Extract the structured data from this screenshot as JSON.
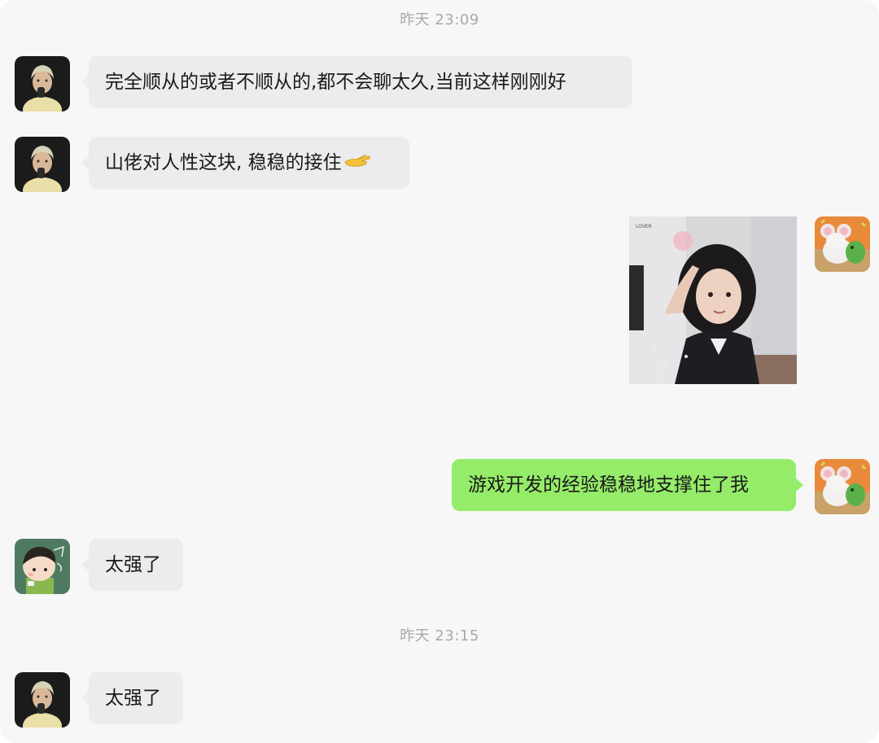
{
  "timestamps": [
    "昨天 23:09",
    "昨天 23:15"
  ],
  "messages": [
    {
      "sender": "friend",
      "text": "完全顺从的或者不顺从的,都不会聊太久,当前这样刚刚好"
    },
    {
      "sender": "friend",
      "text": "山佬对人性这块, 稳稳的接住",
      "emoji": "palm-up-hand-icon"
    },
    {
      "sender": "me",
      "type": "image",
      "image_caption": "LOVER"
    },
    {
      "sender": "me",
      "text": "游戏开发的经验稳稳地支撑住了我"
    },
    {
      "sender": "friend2",
      "text": "太强了"
    },
    {
      "sender": "friend",
      "text": "太强了"
    }
  ],
  "colors": {
    "background": "#f7f7f8",
    "incoming_bubble": "#ececee",
    "outgoing_bubble": "#95ec69",
    "timestamp_text": "#a8a8ac"
  }
}
